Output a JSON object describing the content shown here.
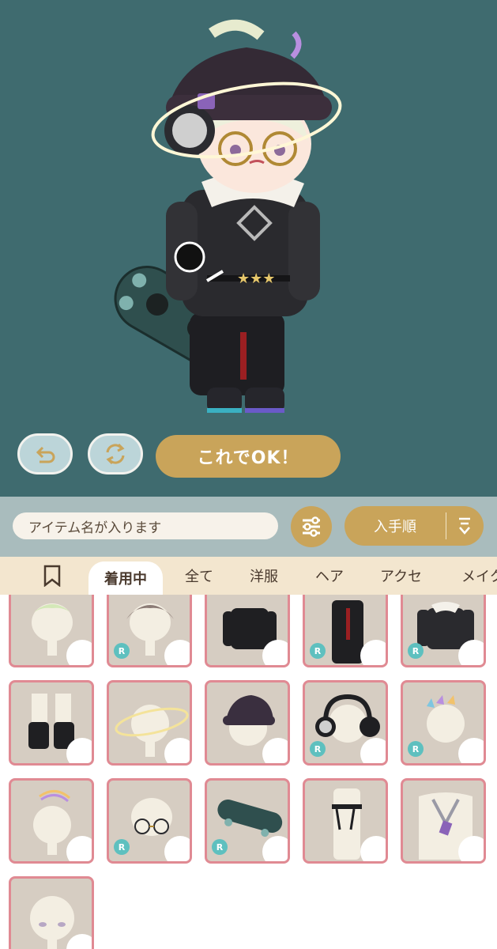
{
  "preview": {
    "undo_icon": "undo-arrow-icon",
    "reset_icon": "refresh-cycle-icon",
    "confirm_label": "これでOK！"
  },
  "toolbar": {
    "search_placeholder": "アイテム名が入ります",
    "filter_icon": "sliders-icon",
    "sort_label": "入手順",
    "sort_icon": "sort-descending-icon"
  },
  "tabs": [
    {
      "label": "着用中",
      "active": true
    },
    {
      "label": "全て"
    },
    {
      "label": "洋服"
    },
    {
      "label": "ヘア"
    },
    {
      "label": "アクセ"
    },
    {
      "label": "メイク"
    }
  ],
  "items": [
    {
      "kind": "hair-mint",
      "rarity": ""
    },
    {
      "kind": "hair-brown",
      "rarity": "R"
    },
    {
      "kind": "black-top",
      "rarity": ""
    },
    {
      "kind": "black-pants",
      "rarity": "R"
    },
    {
      "kind": "black-jacket",
      "rarity": "R"
    },
    {
      "kind": "boots",
      "rarity": ""
    },
    {
      "kind": "halo",
      "rarity": ""
    },
    {
      "kind": "purple-cap",
      "rarity": ""
    },
    {
      "kind": "headphones",
      "rarity": "R"
    },
    {
      "kind": "rainbow-clips",
      "rarity": "R"
    },
    {
      "kind": "rainbow-ahoge",
      "rarity": ""
    },
    {
      "kind": "round-glasses",
      "rarity": "R"
    },
    {
      "kind": "skateboard",
      "rarity": "R"
    },
    {
      "kind": "belt-chain",
      "rarity": ""
    },
    {
      "kind": "necklace",
      "rarity": ""
    },
    {
      "kind": "makeup-face",
      "rarity": ""
    }
  ],
  "colors": {
    "stage_bg": "#3f6b6f",
    "gold": "#c9a45a",
    "card_border": "#e08a93",
    "rarity_badge": "#5ec0bf"
  }
}
